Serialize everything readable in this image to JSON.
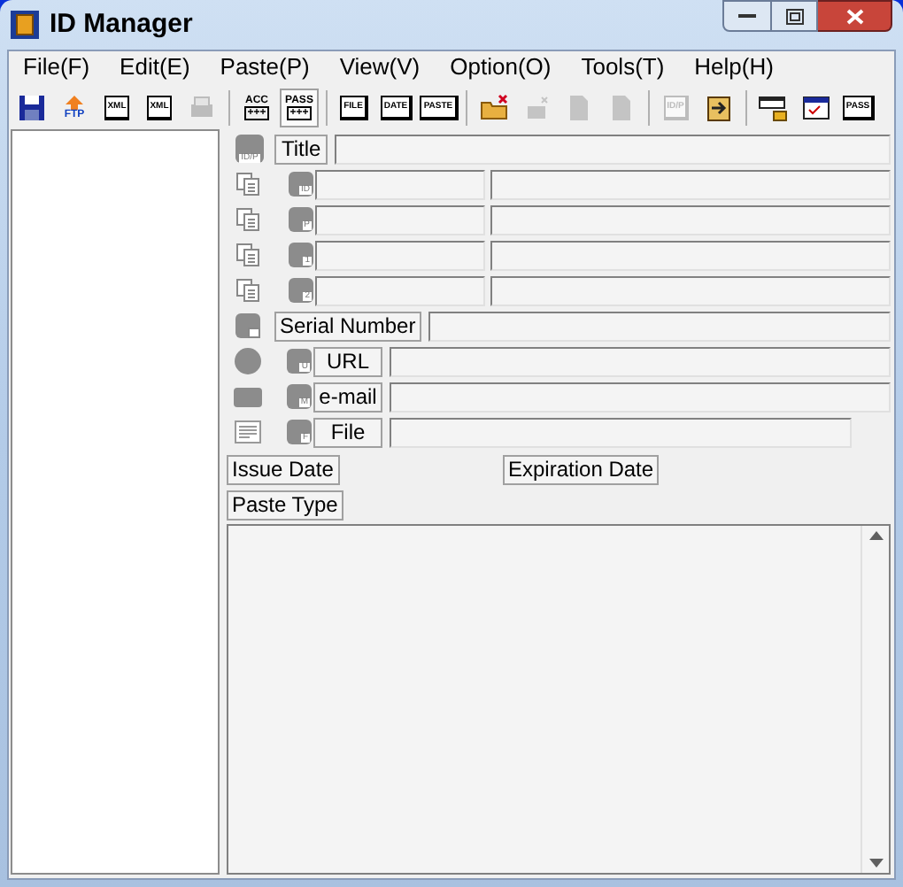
{
  "window": {
    "title": "ID Manager"
  },
  "menu": [
    "File(F)",
    "Edit(E)",
    "Paste(P)",
    "View(V)",
    "Option(O)",
    "Tools(T)",
    "Help(H)"
  ],
  "toolbar": [
    [
      {
        "kind": "save",
        "disabled": false,
        "selected": false
      },
      {
        "kind": "upload",
        "text": "FTP",
        "disabled": false,
        "selected": false
      },
      {
        "kind": "doc-in",
        "text": "XML",
        "disabled": false,
        "selected": false
      },
      {
        "kind": "doc-out",
        "text": "XML",
        "disabled": false,
        "selected": false
      },
      {
        "kind": "printer",
        "disabled": true,
        "selected": false
      }
    ],
    [
      {
        "kind": "tag",
        "text": "ACC",
        "sub": "+++",
        "disabled": false,
        "selected": false
      },
      {
        "kind": "tag",
        "text": "PASS",
        "sub": "+++",
        "disabled": false,
        "selected": true
      }
    ],
    [
      {
        "kind": "sheet",
        "text": "FILE",
        "disabled": false,
        "selected": false
      },
      {
        "kind": "sheet",
        "text": "DATE",
        "disabled": false,
        "selected": false
      },
      {
        "kind": "sheet",
        "text": "PASTE",
        "disabled": false,
        "selected": false
      }
    ],
    [
      {
        "kind": "folder",
        "disabled": false,
        "selected": false
      },
      {
        "kind": "folder",
        "disabled": true,
        "selected": false
      },
      {
        "kind": "page",
        "disabled": true,
        "selected": false
      },
      {
        "kind": "page",
        "disabled": true,
        "selected": false
      }
    ],
    [
      {
        "kind": "sheet",
        "text": "ID/P",
        "disabled": true,
        "selected": false
      },
      {
        "kind": "clipboard",
        "disabled": false,
        "selected": false
      }
    ],
    [
      {
        "kind": "lock",
        "disabled": false,
        "selected": false
      },
      {
        "kind": "window",
        "disabled": false,
        "selected": false
      },
      {
        "kind": "sheet",
        "text": "PASS",
        "disabled": false,
        "selected": false
      }
    ]
  ],
  "title_row": {
    "icon_text": "ID/P",
    "label": "Title"
  },
  "pair_rows": [
    {
      "icon_text": "ID"
    },
    {
      "icon_text": "P"
    },
    {
      "icon_text": "1"
    },
    {
      "icon_text": "2"
    }
  ],
  "serial_row": {
    "label": "Serial Number"
  },
  "link_rows": [
    {
      "kind": "globe",
      "icon_text": "U",
      "label": "URL"
    },
    {
      "kind": "mail",
      "icon_text": "M",
      "label": "e-mail"
    },
    {
      "kind": "file",
      "icon_text": "F",
      "label": "File"
    }
  ],
  "issue_date": {
    "label": "Issue Date"
  },
  "expiration_date": {
    "label": "Expiration Date"
  },
  "paste_type": {
    "label": "Paste Type"
  }
}
